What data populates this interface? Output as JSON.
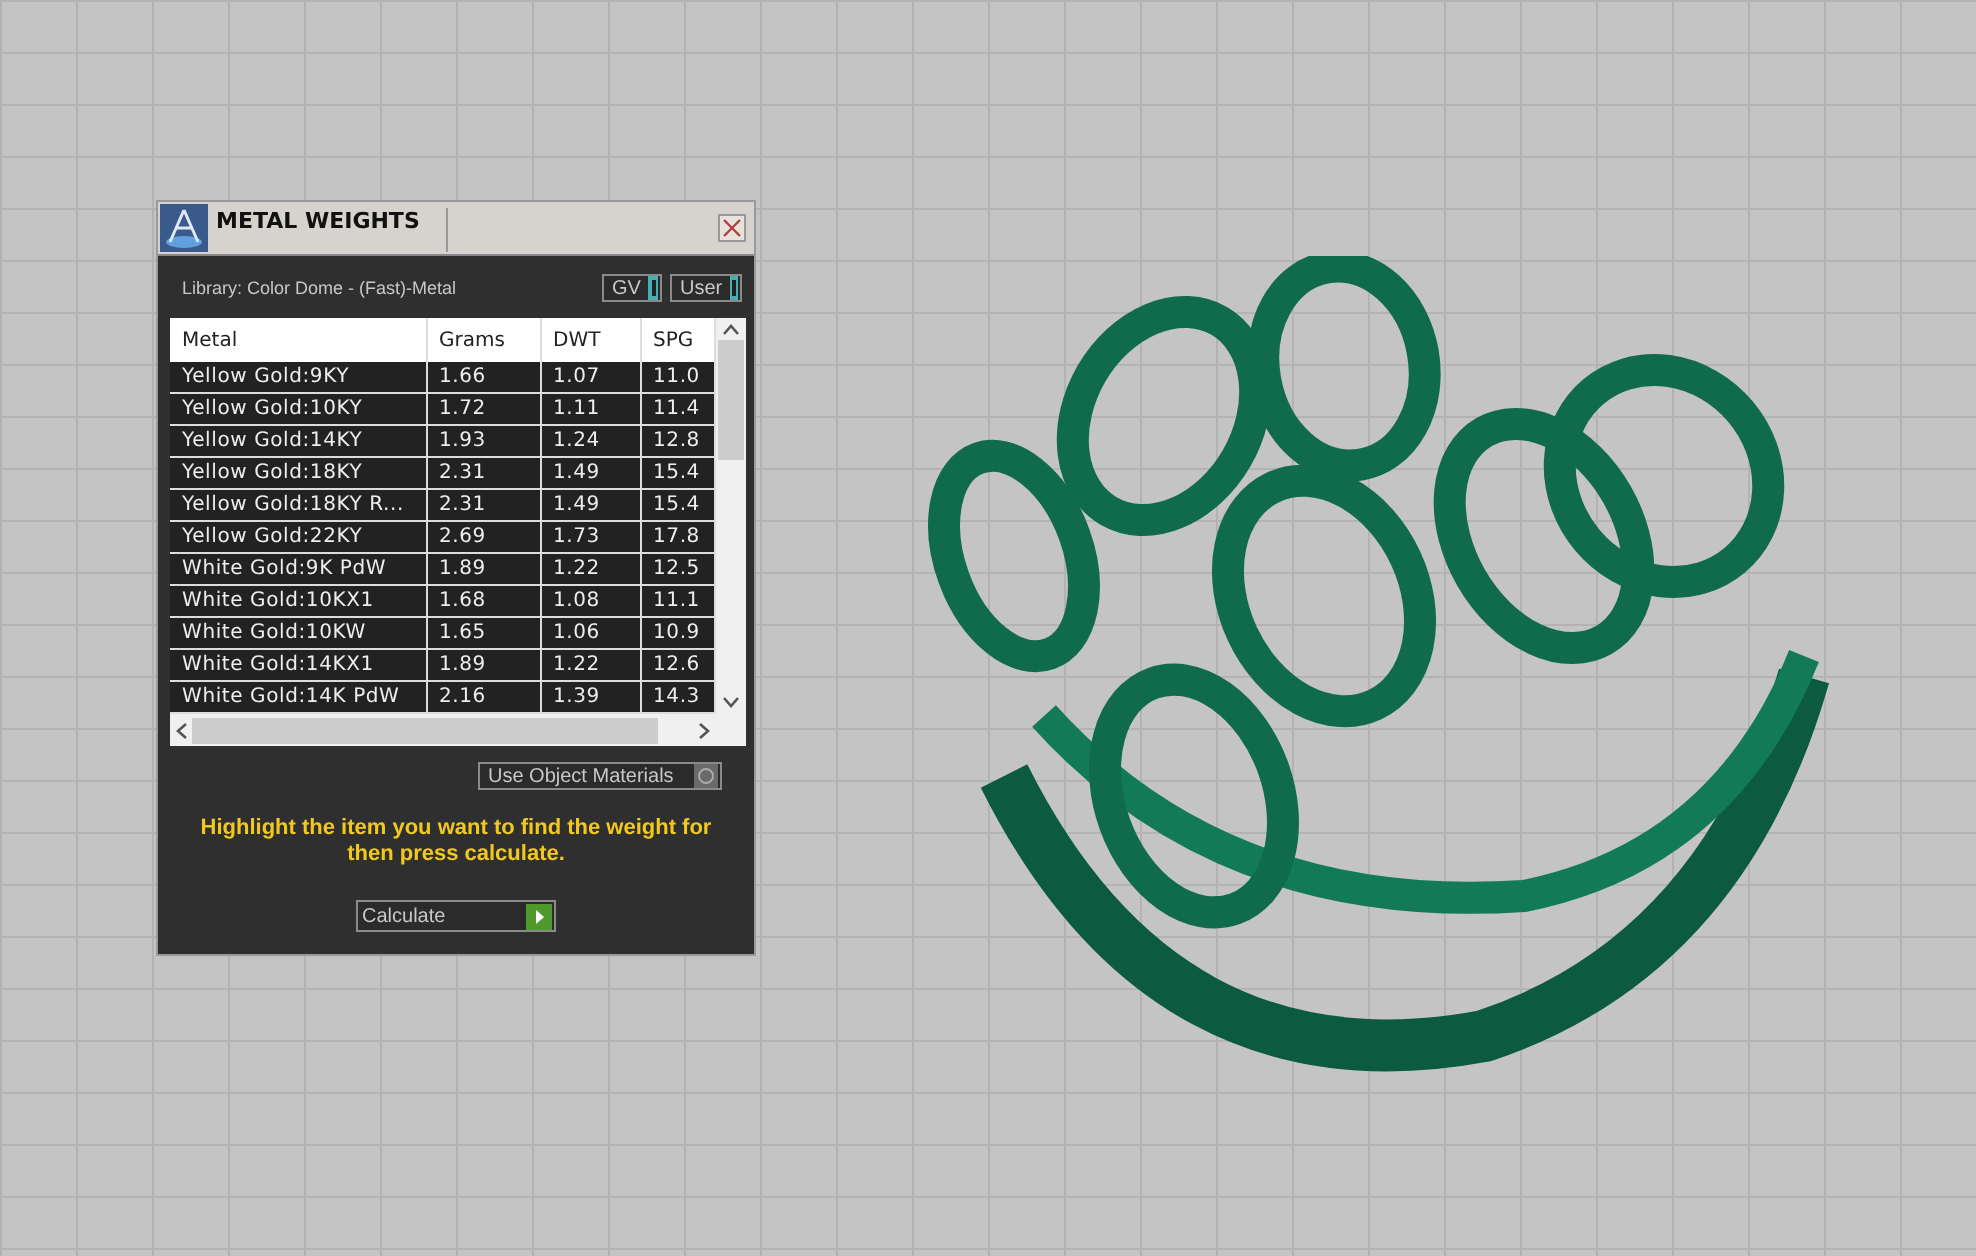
{
  "window": {
    "title": "METAL WEIGHTS"
  },
  "library": {
    "label": "Library: Color Dome - (Fast)-Metal"
  },
  "toggles": [
    {
      "label": "GV",
      "on": true
    },
    {
      "label": "User",
      "on": true
    }
  ],
  "table": {
    "columns": [
      "Metal",
      "Grams",
      "DWT",
      "SPG"
    ],
    "rows": [
      [
        "Yellow Gold:9KY",
        "1.66",
        "1.07",
        "11.0"
      ],
      [
        "Yellow Gold:10KY",
        "1.72",
        "1.11",
        "11.4"
      ],
      [
        "Yellow Gold:14KY",
        "1.93",
        "1.24",
        "12.8"
      ],
      [
        "Yellow Gold:18KY",
        "2.31",
        "1.49",
        "15.4"
      ],
      [
        "Yellow Gold:18KY R...",
        "2.31",
        "1.49",
        "15.4"
      ],
      [
        "Yellow Gold:22KY",
        "2.69",
        "1.73",
        "17.8"
      ],
      [
        "White Gold:9K PdW",
        "1.89",
        "1.22",
        "12.5"
      ],
      [
        "White Gold:10KX1",
        "1.68",
        "1.08",
        "11.1"
      ],
      [
        "White Gold:10KW",
        "1.65",
        "1.06",
        "10.9"
      ],
      [
        "White Gold:14KX1",
        "1.89",
        "1.22",
        "12.6"
      ],
      [
        "White Gold:14K PdW",
        "2.16",
        "1.39",
        "14.3"
      ]
    ]
  },
  "use_object_materials": {
    "label": "Use Object Materials",
    "on": false
  },
  "hint": "Highlight the item you want to find the weight for then press calculate.",
  "calculate_button": {
    "label": "Calculate"
  }
}
